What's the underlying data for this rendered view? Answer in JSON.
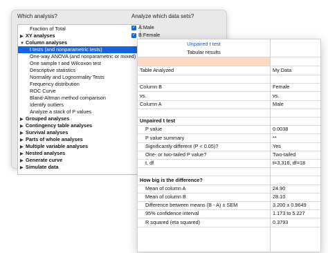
{
  "analysis_dialog": {
    "which_analysis_label": "Which analysis?",
    "analyze_label": "Analyze which data sets?",
    "tree": [
      {
        "label": "Fraction of Total",
        "level": 2,
        "arrow": "",
        "bold": false,
        "selected": false
      },
      {
        "label": "XY analyses",
        "level": 0,
        "arrow": "▶",
        "bold": true,
        "selected": false
      },
      {
        "label": "Column analyses",
        "level": 0,
        "arrow": "▼",
        "bold": true,
        "selected": false
      },
      {
        "label": "t tests (and nonparametric tests)",
        "level": 2,
        "arrow": "",
        "bold": false,
        "selected": true
      },
      {
        "label": "One-way ANOVA (and nonparametric or mixed)",
        "level": 2,
        "arrow": "",
        "bold": false,
        "selected": false
      },
      {
        "label": "One sample t and Wilcoxon test",
        "level": 2,
        "arrow": "",
        "bold": false,
        "selected": false
      },
      {
        "label": "Descriptive statistics",
        "level": 2,
        "arrow": "",
        "bold": false,
        "selected": false
      },
      {
        "label": "Normality and Lognormality Tests",
        "level": 2,
        "arrow": "",
        "bold": false,
        "selected": false
      },
      {
        "label": "Frequency distribution",
        "level": 2,
        "arrow": "",
        "bold": false,
        "selected": false
      },
      {
        "label": "ROC Curve",
        "level": 2,
        "arrow": "",
        "bold": false,
        "selected": false
      },
      {
        "label": "Bland-Altman method comparison",
        "level": 2,
        "arrow": "",
        "bold": false,
        "selected": false
      },
      {
        "label": "Identify outliers",
        "level": 2,
        "arrow": "",
        "bold": false,
        "selected": false
      },
      {
        "label": "Analyze a stack of P values",
        "level": 2,
        "arrow": "",
        "bold": false,
        "selected": false
      },
      {
        "label": "Grouped analyses",
        "level": 0,
        "arrow": "▶",
        "bold": true,
        "selected": false
      },
      {
        "label": "Contingency table analyses",
        "level": 0,
        "arrow": "▶",
        "bold": true,
        "selected": false
      },
      {
        "label": "Survival analyses",
        "level": 0,
        "arrow": "▶",
        "bold": true,
        "selected": false
      },
      {
        "label": "Parts of whole analyses",
        "level": 0,
        "arrow": "▶",
        "bold": true,
        "selected": false
      },
      {
        "label": "Multiple variable analyses",
        "level": 0,
        "arrow": "▶",
        "bold": true,
        "selected": false
      },
      {
        "label": "Nested analyses",
        "level": 0,
        "arrow": "▶",
        "bold": true,
        "selected": false
      },
      {
        "label": "Generate curve",
        "level": 0,
        "arrow": "▶",
        "bold": true,
        "selected": false
      },
      {
        "label": "Simulate data",
        "level": 0,
        "arrow": "▶",
        "bold": true,
        "selected": false
      }
    ],
    "datasets": [
      {
        "label": "A:Male",
        "checked": true
      },
      {
        "label": "B:Female",
        "checked": true
      }
    ]
  },
  "results": {
    "title": "Unpaired t test",
    "subtitle": "Tabular results",
    "rows": [
      {
        "left": "Table Analyzed",
        "right": "My Data",
        "indent": false,
        "bold": false
      },
      {
        "left": "",
        "right": "",
        "indent": false,
        "bold": false
      },
      {
        "left": "Column B",
        "right": "Female",
        "indent": false,
        "bold": false
      },
      {
        "left": "vs.",
        "right": "vs.",
        "indent": false,
        "bold": false
      },
      {
        "left": "Column A",
        "right": "Male",
        "indent": false,
        "bold": false
      },
      {
        "left": "",
        "right": "",
        "indent": false,
        "bold": false
      },
      {
        "left": "Unpaired t test",
        "right": "",
        "indent": false,
        "bold": true
      },
      {
        "left": "P value",
        "right": "0.0038",
        "indent": true,
        "bold": false
      },
      {
        "left": "P value summary",
        "right": "**",
        "indent": true,
        "bold": false
      },
      {
        "left": "Significantly different (P < 0.05)?",
        "right": "Yes",
        "indent": true,
        "bold": false
      },
      {
        "left": "One- or two-tailed P value?",
        "right": "Two-tailed",
        "indent": true,
        "bold": false
      },
      {
        "left": "t, df",
        "right": "t=3.316, df=18",
        "indent": true,
        "bold": false
      },
      {
        "left": "",
        "right": "",
        "indent": false,
        "bold": false
      },
      {
        "left": "How big is the difference?",
        "right": "",
        "indent": false,
        "bold": true
      },
      {
        "left": "Mean of column A",
        "right": "24.90",
        "indent": true,
        "bold": false
      },
      {
        "left": "Mean of column B",
        "right": "28.10",
        "indent": true,
        "bold": false
      },
      {
        "left": "Difference between means (B - A) ± SEM",
        "right": "3.200 ± 0.9649",
        "indent": true,
        "bold": false
      },
      {
        "left": "95% confidence interval",
        "right": "1.173 to 5.227",
        "indent": true,
        "bold": false
      },
      {
        "left": "R squared (eta squared)",
        "right": "0.3793",
        "indent": true,
        "bold": false
      }
    ]
  },
  "colors": {
    "selection": "#1565e0",
    "title_blue": "#1b55c4",
    "peach_row": "#fcd9c2",
    "dialog_bg": "#e9e9e9"
  }
}
